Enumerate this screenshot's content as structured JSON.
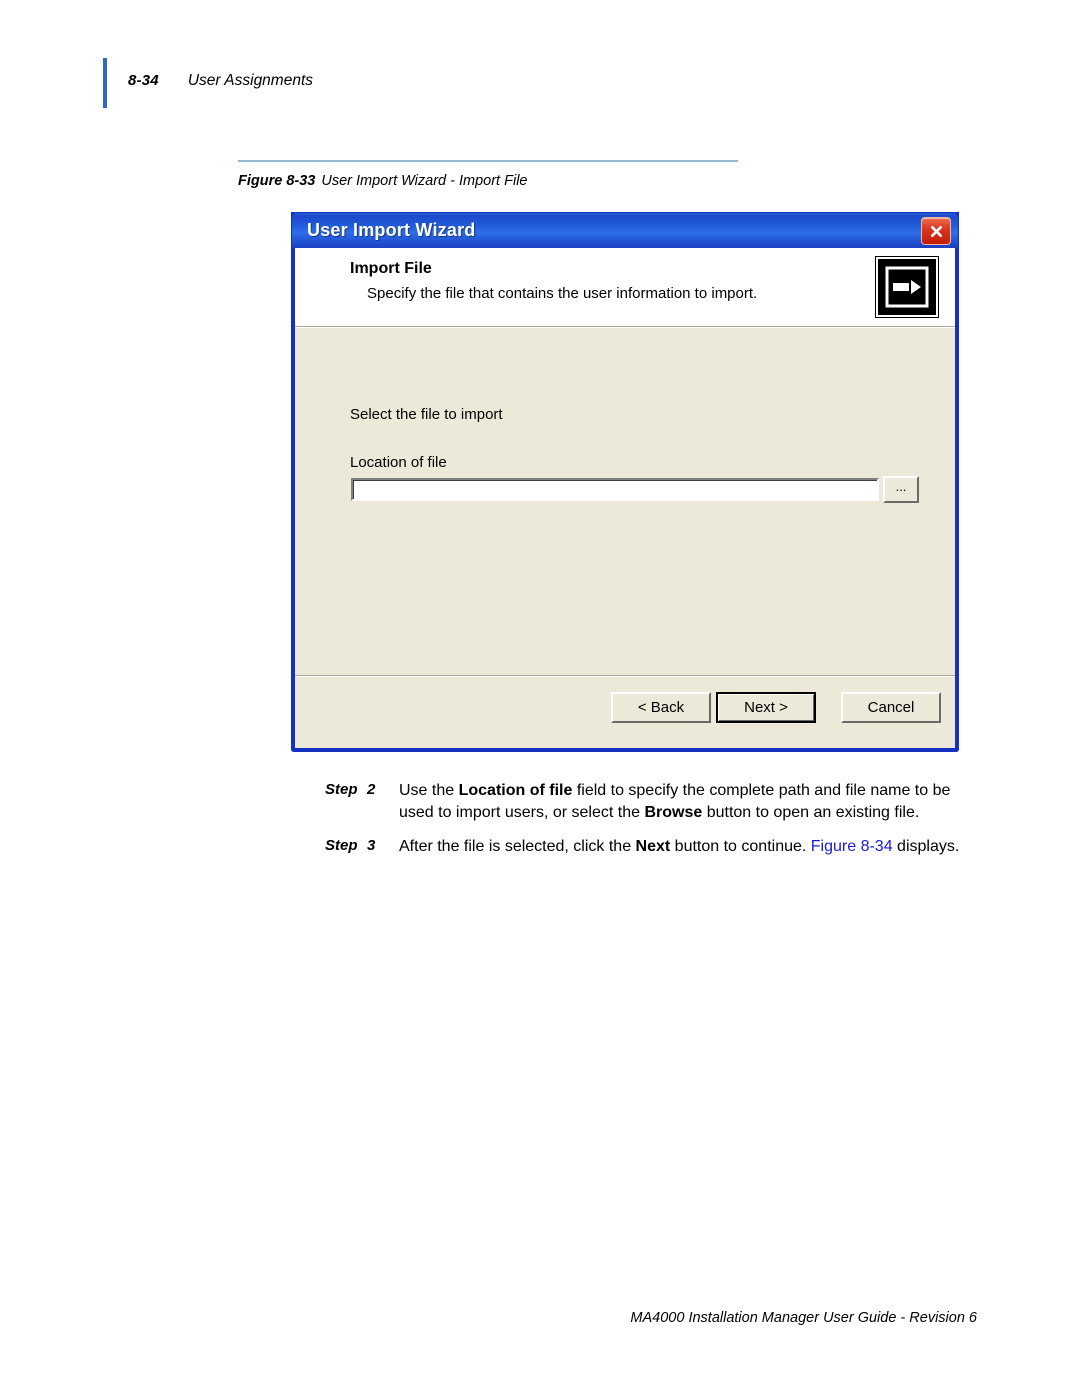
{
  "page": {
    "folio": "8-34",
    "running_head": "User Assignments",
    "footer": "MA4000 Installation Manager User Guide - Revision 6",
    "accent_color": "#2f67c8",
    "caption_rule_color": "#93b7d4",
    "xref_color": "#1a1ae0"
  },
  "figure": {
    "label": "Figure 8-33",
    "text": "User Import Wizard - Import File"
  },
  "dialog": {
    "title": "User Import Wizard",
    "close_icon": "close-icon",
    "titlebar_color": "#2058d8",
    "body_color": "#ece9d8",
    "header": {
      "title": "Import File",
      "subtitle": "Specify the file that contains the user information to import.",
      "icon": "arrow-right-icon"
    },
    "body": {
      "instruction": "Select the file to import",
      "field_label": "Location of file",
      "field_value": "",
      "field_placeholder": "",
      "browse_label": "..."
    },
    "buttons": [
      {
        "label": "< Back",
        "name": "back-button",
        "default": false
      },
      {
        "label": "Next >",
        "name": "next-button",
        "default": true
      },
      {
        "label": "Cancel",
        "name": "cancel-button",
        "default": false
      }
    ]
  },
  "steps": [
    {
      "label": "Step",
      "number": "2",
      "parts": [
        {
          "text": "Use the ",
          "style": "normal"
        },
        {
          "text": "Location of file",
          "style": "bold"
        },
        {
          "text": " field to specify the complete path and file name to be used to import users, or select the ",
          "style": "normal"
        },
        {
          "text": "Browse",
          "style": "bold"
        },
        {
          "text": " button to open an existing file.",
          "style": "normal"
        }
      ]
    },
    {
      "label": "Step",
      "number": "3",
      "parts": [
        {
          "text": "After the file is selected, click the ",
          "style": "normal"
        },
        {
          "text": "Next",
          "style": "bold"
        },
        {
          "text": " button to continue. ",
          "style": "normal"
        },
        {
          "text": "Figure 8-34",
          "style": "xref"
        },
        {
          "text": " displays.",
          "style": "normal"
        }
      ]
    }
  ]
}
